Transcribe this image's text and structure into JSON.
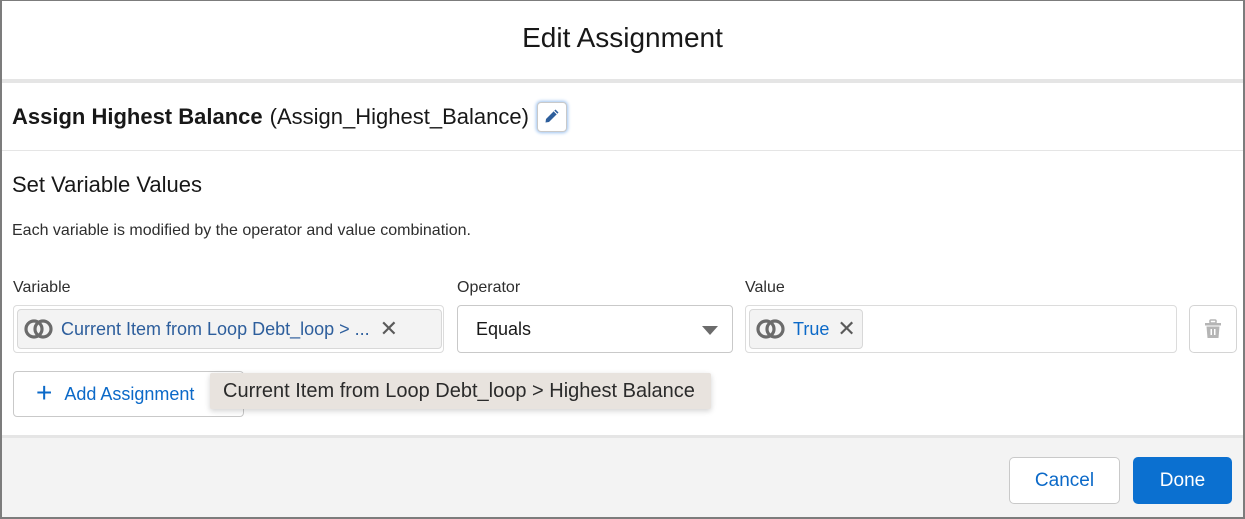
{
  "dialog": {
    "title": "Edit Assignment"
  },
  "element": {
    "label": "Assign Highest Balance",
    "api_name": "(Assign_Highest_Balance)",
    "edit_icon": "pencil-icon"
  },
  "section": {
    "title": "Set Variable Values",
    "description": "Each variable is modified by the operator and value combination."
  },
  "columns": {
    "variable": "Variable",
    "operator": "Operator",
    "value": "Value"
  },
  "assignment_row": {
    "variable": {
      "icon": "resource-merge-icon",
      "text": "Current Item from Loop Debt_loop > ...",
      "remove_icon": "close-icon"
    },
    "operator": {
      "selected": "Equals",
      "icon": "caret-down-icon"
    },
    "value": {
      "icon": "resource-merge-icon",
      "text": "True",
      "remove_icon": "close-icon"
    },
    "delete_icon": "trash-icon"
  },
  "add_assignment": {
    "icon": "plus-icon",
    "label": "Add Assignment"
  },
  "tooltip": {
    "text": "Current Item from Loop Debt_loop > Highest Balance"
  },
  "footer": {
    "cancel_label": "Cancel",
    "done_label": "Done"
  },
  "colors": {
    "brand": "#0b70d0",
    "link": "#0b69c8",
    "pill_text": "#2d5e9c"
  }
}
